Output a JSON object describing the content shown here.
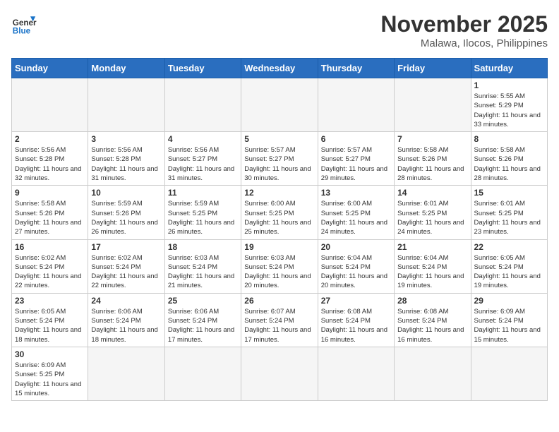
{
  "header": {
    "logo_general": "General",
    "logo_blue": "Blue",
    "month_title": "November 2025",
    "location": "Malawa, Ilocos, Philippines"
  },
  "days_of_week": [
    "Sunday",
    "Monday",
    "Tuesday",
    "Wednesday",
    "Thursday",
    "Friday",
    "Saturday"
  ],
  "weeks": [
    [
      {
        "day": "",
        "empty": true
      },
      {
        "day": "",
        "empty": true
      },
      {
        "day": "",
        "empty": true
      },
      {
        "day": "",
        "empty": true
      },
      {
        "day": "",
        "empty": true
      },
      {
        "day": "",
        "empty": true
      },
      {
        "day": "1",
        "sunrise": "5:55 AM",
        "sunset": "5:29 PM",
        "daylight": "11 hours and 33 minutes."
      }
    ],
    [
      {
        "day": "2",
        "sunrise": "5:56 AM",
        "sunset": "5:28 PM",
        "daylight": "11 hours and 32 minutes."
      },
      {
        "day": "3",
        "sunrise": "5:56 AM",
        "sunset": "5:28 PM",
        "daylight": "11 hours and 31 minutes."
      },
      {
        "day": "4",
        "sunrise": "5:56 AM",
        "sunset": "5:27 PM",
        "daylight": "11 hours and 31 minutes."
      },
      {
        "day": "5",
        "sunrise": "5:57 AM",
        "sunset": "5:27 PM",
        "daylight": "11 hours and 30 minutes."
      },
      {
        "day": "6",
        "sunrise": "5:57 AM",
        "sunset": "5:27 PM",
        "daylight": "11 hours and 29 minutes."
      },
      {
        "day": "7",
        "sunrise": "5:58 AM",
        "sunset": "5:26 PM",
        "daylight": "11 hours and 28 minutes."
      },
      {
        "day": "8",
        "sunrise": "5:58 AM",
        "sunset": "5:26 PM",
        "daylight": "11 hours and 28 minutes."
      }
    ],
    [
      {
        "day": "9",
        "sunrise": "5:58 AM",
        "sunset": "5:26 PM",
        "daylight": "11 hours and 27 minutes."
      },
      {
        "day": "10",
        "sunrise": "5:59 AM",
        "sunset": "5:26 PM",
        "daylight": "11 hours and 26 minutes."
      },
      {
        "day": "11",
        "sunrise": "5:59 AM",
        "sunset": "5:25 PM",
        "daylight": "11 hours and 26 minutes."
      },
      {
        "day": "12",
        "sunrise": "6:00 AM",
        "sunset": "5:25 PM",
        "daylight": "11 hours and 25 minutes."
      },
      {
        "day": "13",
        "sunrise": "6:00 AM",
        "sunset": "5:25 PM",
        "daylight": "11 hours and 24 minutes."
      },
      {
        "day": "14",
        "sunrise": "6:01 AM",
        "sunset": "5:25 PM",
        "daylight": "11 hours and 24 minutes."
      },
      {
        "day": "15",
        "sunrise": "6:01 AM",
        "sunset": "5:25 PM",
        "daylight": "11 hours and 23 minutes."
      }
    ],
    [
      {
        "day": "16",
        "sunrise": "6:02 AM",
        "sunset": "5:24 PM",
        "daylight": "11 hours and 22 minutes."
      },
      {
        "day": "17",
        "sunrise": "6:02 AM",
        "sunset": "5:24 PM",
        "daylight": "11 hours and 22 minutes."
      },
      {
        "day": "18",
        "sunrise": "6:03 AM",
        "sunset": "5:24 PM",
        "daylight": "11 hours and 21 minutes."
      },
      {
        "day": "19",
        "sunrise": "6:03 AM",
        "sunset": "5:24 PM",
        "daylight": "11 hours and 20 minutes."
      },
      {
        "day": "20",
        "sunrise": "6:04 AM",
        "sunset": "5:24 PM",
        "daylight": "11 hours and 20 minutes."
      },
      {
        "day": "21",
        "sunrise": "6:04 AM",
        "sunset": "5:24 PM",
        "daylight": "11 hours and 19 minutes."
      },
      {
        "day": "22",
        "sunrise": "6:05 AM",
        "sunset": "5:24 PM",
        "daylight": "11 hours and 19 minutes."
      }
    ],
    [
      {
        "day": "23",
        "sunrise": "6:05 AM",
        "sunset": "5:24 PM",
        "daylight": "11 hours and 18 minutes."
      },
      {
        "day": "24",
        "sunrise": "6:06 AM",
        "sunset": "5:24 PM",
        "daylight": "11 hours and 18 minutes."
      },
      {
        "day": "25",
        "sunrise": "6:06 AM",
        "sunset": "5:24 PM",
        "daylight": "11 hours and 17 minutes."
      },
      {
        "day": "26",
        "sunrise": "6:07 AM",
        "sunset": "5:24 PM",
        "daylight": "11 hours and 17 minutes."
      },
      {
        "day": "27",
        "sunrise": "6:08 AM",
        "sunset": "5:24 PM",
        "daylight": "11 hours and 16 minutes."
      },
      {
        "day": "28",
        "sunrise": "6:08 AM",
        "sunset": "5:24 PM",
        "daylight": "11 hours and 16 minutes."
      },
      {
        "day": "29",
        "sunrise": "6:09 AM",
        "sunset": "5:24 PM",
        "daylight": "11 hours and 15 minutes."
      }
    ],
    [
      {
        "day": "30",
        "sunrise": "6:09 AM",
        "sunset": "5:25 PM",
        "daylight": "11 hours and 15 minutes."
      },
      {
        "day": "",
        "empty": true
      },
      {
        "day": "",
        "empty": true
      },
      {
        "day": "",
        "empty": true
      },
      {
        "day": "",
        "empty": true
      },
      {
        "day": "",
        "empty": true
      },
      {
        "day": "",
        "empty": true
      }
    ]
  ]
}
